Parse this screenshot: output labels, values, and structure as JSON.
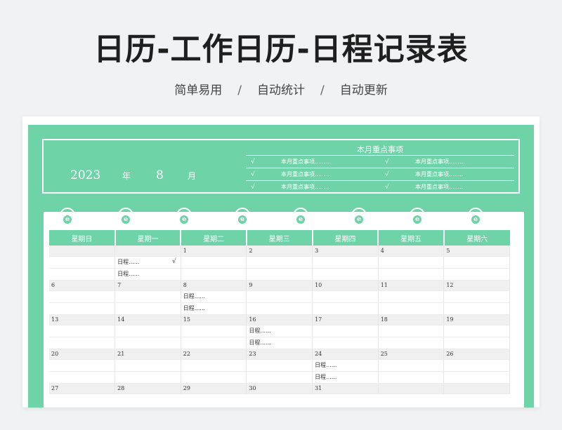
{
  "title": "日历-工作日历-日程记录表",
  "subtitle": [
    "简单易用",
    "自动统计",
    "自动更新"
  ],
  "subtitle_sep": "/",
  "year": "2023",
  "year_unit": "年",
  "month": "8",
  "month_unit": "月",
  "important": {
    "title": "本月重点事项",
    "check": "√",
    "item": "本月重点事项.........",
    "rows": 3
  },
  "weekdays": [
    "星期日",
    "星期一",
    "星期二",
    "星期三",
    "星期四",
    "星期五",
    "星期六"
  ],
  "weeks": [
    {
      "days": [
        "",
        "",
        "1",
        "2",
        "3",
        "4",
        "5"
      ],
      "slot1": [
        "",
        "日程......",
        "",
        "",
        "",
        "",
        ""
      ],
      "slot2": [
        "",
        "日程......",
        "",
        "",
        "",
        "",
        ""
      ],
      "check": [
        false,
        true,
        false,
        false,
        false,
        false,
        false
      ]
    },
    {
      "days": [
        "6",
        "7",
        "8",
        "9",
        "10",
        "11",
        "12"
      ],
      "slot1": [
        "",
        "",
        "日程......",
        "",
        "",
        "",
        ""
      ],
      "slot2": [
        "",
        "",
        "日程......",
        "",
        "",
        "",
        ""
      ],
      "check": [
        false,
        false,
        false,
        false,
        false,
        false,
        false
      ]
    },
    {
      "days": [
        "13",
        "14",
        "15",
        "16",
        "17",
        "18",
        "19"
      ],
      "slot1": [
        "",
        "",
        "",
        "日程......",
        "",
        "",
        ""
      ],
      "slot2": [
        "",
        "",
        "",
        "日程......",
        "",
        "",
        ""
      ],
      "check": [
        false,
        false,
        false,
        false,
        false,
        false,
        false
      ]
    },
    {
      "days": [
        "20",
        "21",
        "22",
        "23",
        "24",
        "25",
        "26"
      ],
      "slot1": [
        "",
        "",
        "",
        "",
        "日程......",
        "",
        ""
      ],
      "slot2": [
        "",
        "",
        "",
        "",
        "日程......",
        "",
        ""
      ],
      "check": [
        false,
        false,
        false,
        false,
        false,
        false,
        false
      ]
    },
    {
      "days": [
        "27",
        "28",
        "29",
        "30",
        "31",
        "",
        ""
      ],
      "slot1": [
        "",
        "",
        "",
        "",
        "",
        "",
        ""
      ],
      "slot2": [
        "",
        "",
        "",
        "",
        "",
        "",
        ""
      ],
      "check": [
        false,
        false,
        false,
        false,
        false,
        false,
        false
      ]
    }
  ],
  "check_mark": "√",
  "colors": {
    "accent": "#6fd3a8",
    "background": "#f1f2f4",
    "title": "#1f1f1f"
  }
}
